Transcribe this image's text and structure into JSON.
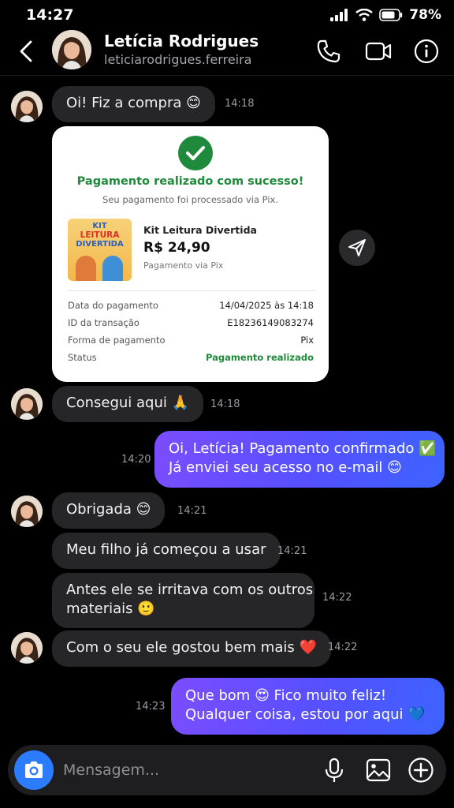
{
  "status_bar": {
    "time": "14:27",
    "battery": "78%"
  },
  "header": {
    "name": "Letícia Rodrigues",
    "username": "leticiarodrigues.ferreira"
  },
  "messages": [
    {
      "dir": "in",
      "text": "Oi! Fiz a compra 😊",
      "time": "14:18"
    },
    {
      "dir": "in",
      "text": "Consegui aqui 🙏",
      "time": "14:18"
    },
    {
      "dir": "out",
      "line1": "Oi, Letícia! Pagamento confirmado ✅",
      "line2": "Já enviei seu acesso no e-mail 😊",
      "time": "14:20"
    },
    {
      "dir": "in",
      "text": "Obrigada 😊",
      "time": "14:21"
    },
    {
      "dir": "in",
      "text": "Meu filho já começou a usar",
      "time": "14:21"
    },
    {
      "dir": "in",
      "line1": "Antes ele se irritava com os outros",
      "line2": "materiais 🙂",
      "time": "14:22"
    },
    {
      "dir": "in",
      "text": "Com o seu ele gostou bem mais ❤️",
      "time": "14:22"
    },
    {
      "dir": "out",
      "line1": "Que bom 😍 Fico muito feliz!",
      "line2": "Qualquer coisa, estou por aqui 💙",
      "time": "14:23"
    }
  ],
  "payment_card": {
    "title": "Pagamento realizado com sucesso!",
    "subtitle": "Seu pagamento foi processado via Pix.",
    "product_image_text": {
      "l1": "KIT",
      "l2": "LEITURA",
      "l3": "DIVERTIDA"
    },
    "product_name": "Kit Leitura Divertida",
    "price": "R$ 24,90",
    "method_note": "Pagamento via Pix",
    "details": [
      {
        "label": "Data do pagamento",
        "value": "14/04/2025 às 14:18"
      },
      {
        "label": "ID da transação",
        "value": "E18236149083274"
      },
      {
        "label": "Forma de pagamento",
        "value": "Pix"
      },
      {
        "label": "Status",
        "value": "Pagamento realizado"
      }
    ]
  },
  "composer": {
    "placeholder": "Mensagem..."
  },
  "icons": {
    "back": "chevron-left-icon",
    "call": "phone-icon",
    "video": "video-camera-icon",
    "info": "info-icon",
    "share": "send-icon",
    "camera": "camera-icon",
    "mic": "microphone-icon",
    "gallery": "image-icon",
    "add": "plus-circle-icon"
  },
  "colors": {
    "outgoing_start": "#7b4dff",
    "outgoing_end": "#3d63ff",
    "incoming": "#262628",
    "success": "#1f8a3b",
    "camera": "#2b7cff"
  }
}
